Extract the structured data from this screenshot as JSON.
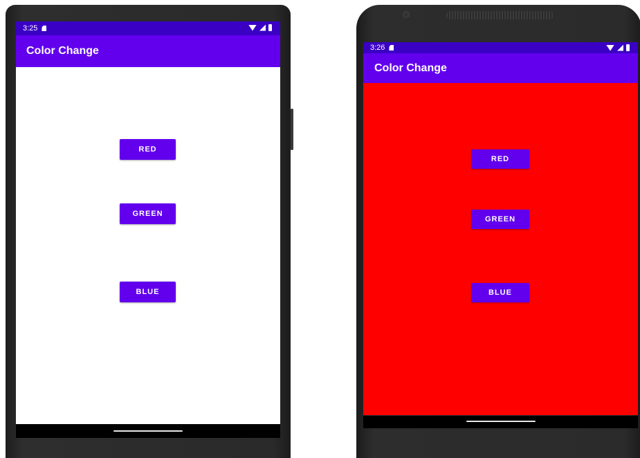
{
  "phones": [
    {
      "status": {
        "time": "3:25"
      },
      "app_title": "Color Change",
      "background_color": "#ffffff",
      "buttons": {
        "red": "RED",
        "green": "GREEN",
        "blue": "BLUE"
      }
    },
    {
      "status": {
        "time": "3:26"
      },
      "app_title": "Color Change",
      "background_color": "#ff0000",
      "buttons": {
        "red": "RED",
        "green": "GREEN",
        "blue": "BLUE"
      }
    }
  ],
  "colors": {
    "status_bar": "#3a00c4",
    "app_bar": "#6200ee",
    "button": "#6200ee",
    "nav_bar": "#000000"
  },
  "icons": [
    "sd-card-icon",
    "wifi-icon",
    "signal-icon",
    "battery-icon",
    "home-handle-icon"
  ]
}
